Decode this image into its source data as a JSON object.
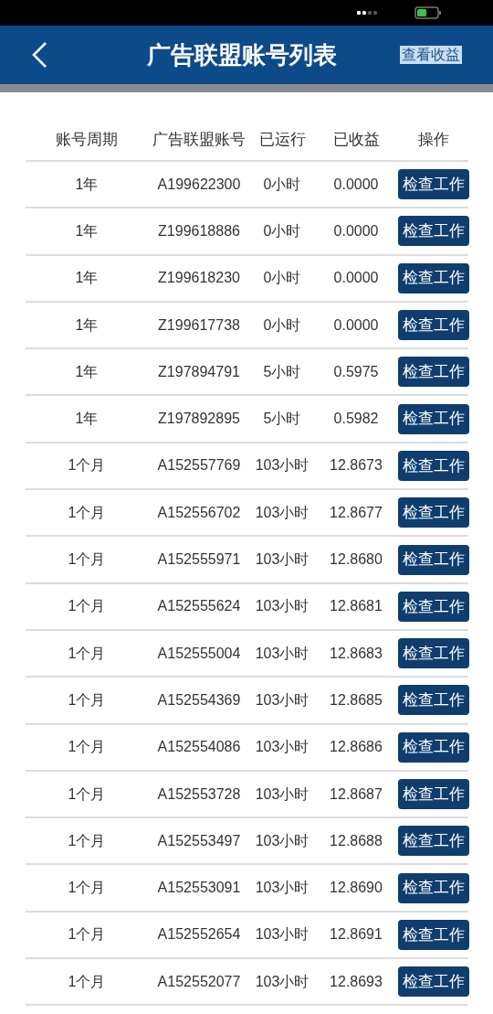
{
  "header": {
    "title": "广告联盟账号列表",
    "action": "查看收益"
  },
  "table": {
    "columns": [
      "账号周期",
      "广告联盟账号",
      "已运行",
      "已收益",
      "操作"
    ],
    "rows": [
      {
        "period": "1年",
        "account": "A199622300",
        "runtime": "0小时",
        "earnings": "0.0000",
        "action": "检查工作"
      },
      {
        "period": "1年",
        "account": "Z199618886",
        "runtime": "0小时",
        "earnings": "0.0000",
        "action": "检查工作"
      },
      {
        "period": "1年",
        "account": "Z199618230",
        "runtime": "0小时",
        "earnings": "0.0000",
        "action": "检查工作"
      },
      {
        "period": "1年",
        "account": "Z199617738",
        "runtime": "0小时",
        "earnings": "0.0000",
        "action": "检查工作"
      },
      {
        "period": "1年",
        "account": "Z197894791",
        "runtime": "5小时",
        "earnings": "0.5975",
        "action": "检查工作"
      },
      {
        "period": "1年",
        "account": "Z197892895",
        "runtime": "5小时",
        "earnings": "0.5982",
        "action": "检查工作"
      },
      {
        "period": "1个月",
        "account": "A152557769",
        "runtime": "103小时",
        "earnings": "12.8673",
        "action": "检查工作"
      },
      {
        "period": "1个月",
        "account": "A152556702",
        "runtime": "103小时",
        "earnings": "12.8677",
        "action": "检查工作"
      },
      {
        "period": "1个月",
        "account": "A152555971",
        "runtime": "103小时",
        "earnings": "12.8680",
        "action": "检查工作"
      },
      {
        "period": "1个月",
        "account": "A152555624",
        "runtime": "103小时",
        "earnings": "12.8681",
        "action": "检查工作"
      },
      {
        "period": "1个月",
        "account": "A152555004",
        "runtime": "103小时",
        "earnings": "12.8683",
        "action": "检查工作"
      },
      {
        "period": "1个月",
        "account": "A152554369",
        "runtime": "103小时",
        "earnings": "12.8685",
        "action": "检查工作"
      },
      {
        "period": "1个月",
        "account": "A152554086",
        "runtime": "103小时",
        "earnings": "12.8686",
        "action": "检查工作"
      },
      {
        "period": "1个月",
        "account": "A152553728",
        "runtime": "103小时",
        "earnings": "12.8687",
        "action": "检查工作"
      },
      {
        "period": "1个月",
        "account": "A152553497",
        "runtime": "103小时",
        "earnings": "12.8688",
        "action": "检查工作"
      },
      {
        "period": "1个月",
        "account": "A152553091",
        "runtime": "103小时",
        "earnings": "12.8690",
        "action": "检查工作"
      },
      {
        "period": "1个月",
        "account": "A152552654",
        "runtime": "103小时",
        "earnings": "12.8691",
        "action": "检查工作"
      },
      {
        "period": "1个月",
        "account": "A152552077",
        "runtime": "103小时",
        "earnings": "12.8693",
        "action": "检查工作"
      }
    ]
  }
}
